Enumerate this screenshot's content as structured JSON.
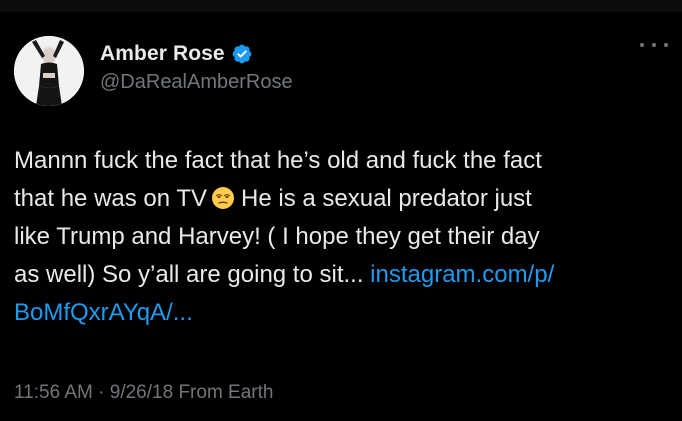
{
  "user": {
    "display_name": "Amber Rose",
    "handle": "@DaRealAmberRose",
    "verified": true,
    "avatar_icon": "avatar-photo"
  },
  "tweet": {
    "line1": "Mannn fuck the fact that he’s old and fuck the fact",
    "line2_a": "that he was on TV",
    "emoji": "unamused-face",
    "line2_b": "He is a sexual predator just",
    "line3": "like Trump and Harvey! ( I hope they get their day",
    "line4_text": "as well) So y’all are going to sit...",
    "link_part1": "instagram.com/p/",
    "link_part2": "BoMfQxrAYqA/..."
  },
  "meta": {
    "time": "11:56 AM",
    "separator": " · ",
    "date": "9/26/18",
    "source": "From Earth"
  },
  "colors": {
    "background": "#000000",
    "text": "#e7e9ea",
    "muted": "#71767b",
    "link": "#1d9bf0",
    "verified": "#1d9bf0"
  },
  "icons": {
    "more": "more-horizontal-icon",
    "verified": "verified-badge-icon"
  }
}
